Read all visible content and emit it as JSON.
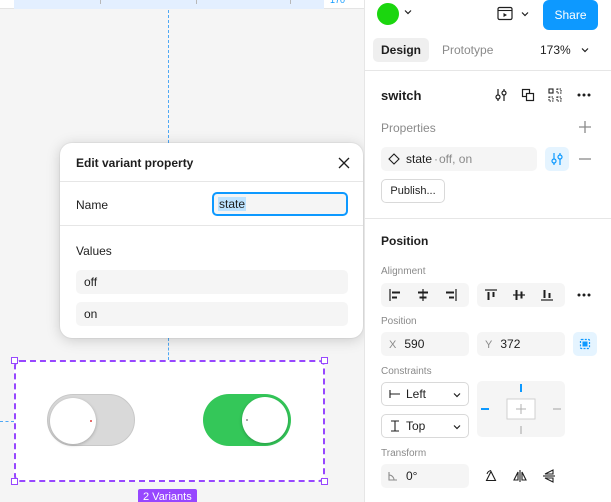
{
  "ruler": {
    "right_value": "170"
  },
  "canvas": {
    "variants_badge": "2 Variants",
    "switches": [
      {
        "state": "off",
        "color": "#d9d9d9"
      },
      {
        "state": "on",
        "color": "#34c759"
      }
    ]
  },
  "popover": {
    "title": "Edit variant property",
    "name_label": "Name",
    "name_value": "state",
    "values_label": "Values",
    "values": [
      "off",
      "on"
    ]
  },
  "header": {
    "avatar_color": "#1bd60f",
    "share_label": "Share",
    "tabs": [
      "Design",
      "Prototype"
    ],
    "active_tab": "Design",
    "zoom": "173%"
  },
  "component": {
    "name": "switch"
  },
  "properties": {
    "title": "Properties",
    "item_name": "state",
    "item_values": "off, on",
    "publish_label": "Publish..."
  },
  "position": {
    "title": "Position",
    "alignment_label": "Alignment",
    "position_label": "Position",
    "x_prefix": "X",
    "x_value": "590",
    "y_prefix": "Y",
    "y_value": "372",
    "constraints_label": "Constraints",
    "constraint_h": "Left",
    "constraint_v": "Top",
    "transform_label": "Transform",
    "rotation": "0°"
  },
  "colors": {
    "accent": "#0d99ff",
    "variant_purple": "#9747ff"
  }
}
